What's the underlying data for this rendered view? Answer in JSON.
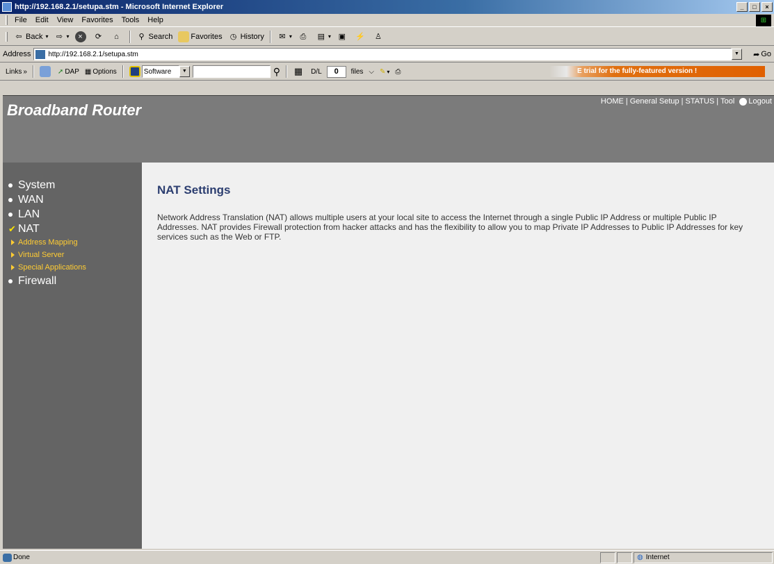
{
  "window": {
    "title": "http://192.168.2.1/setupa.stm - Microsoft Internet Explorer",
    "min": "_",
    "max": "□",
    "close": "×"
  },
  "menu": [
    "File",
    "Edit",
    "View",
    "Favorites",
    "Tools",
    "Help"
  ],
  "toolbar": {
    "back": "Back",
    "search": "Search",
    "favorites": "Favorites",
    "history": "History"
  },
  "address": {
    "label": "Address",
    "url": "http://192.168.2.1/setupa.stm",
    "go": "Go"
  },
  "links_bar": {
    "links": "Links",
    "dap": "DAP",
    "options": "Options",
    "software": "Software",
    "dl": "D/L",
    "count": "0",
    "files": "files",
    "trial": "E trial for the fully-featured version !"
  },
  "page": {
    "brand": "Broadband Router",
    "topnav": [
      "HOME",
      "General Setup",
      "STATUS",
      "Tool"
    ],
    "logout": "Logout",
    "sidebar": [
      {
        "label": "System",
        "marker": "dot"
      },
      {
        "label": "WAN",
        "marker": "dot"
      },
      {
        "label": "LAN",
        "marker": "dot"
      },
      {
        "label": "NAT",
        "marker": "check"
      }
    ],
    "sub_items": [
      "Address Mapping",
      "Virtual Server",
      "Special Applications"
    ],
    "sidebar_after": "Firewall",
    "heading": "NAT Settings",
    "body": "Network Address Translation (NAT) allows multiple users at your local site to access the Internet through a single Public IP Address or multiple Public IP Addresses. NAT provides Firewall protection from hacker attacks and has the flexibility to allow you to map Private IP Addresses to Public IP Addresses for key services such as the Web or FTP."
  },
  "status": {
    "text": "Done",
    "zone": "Internet"
  }
}
